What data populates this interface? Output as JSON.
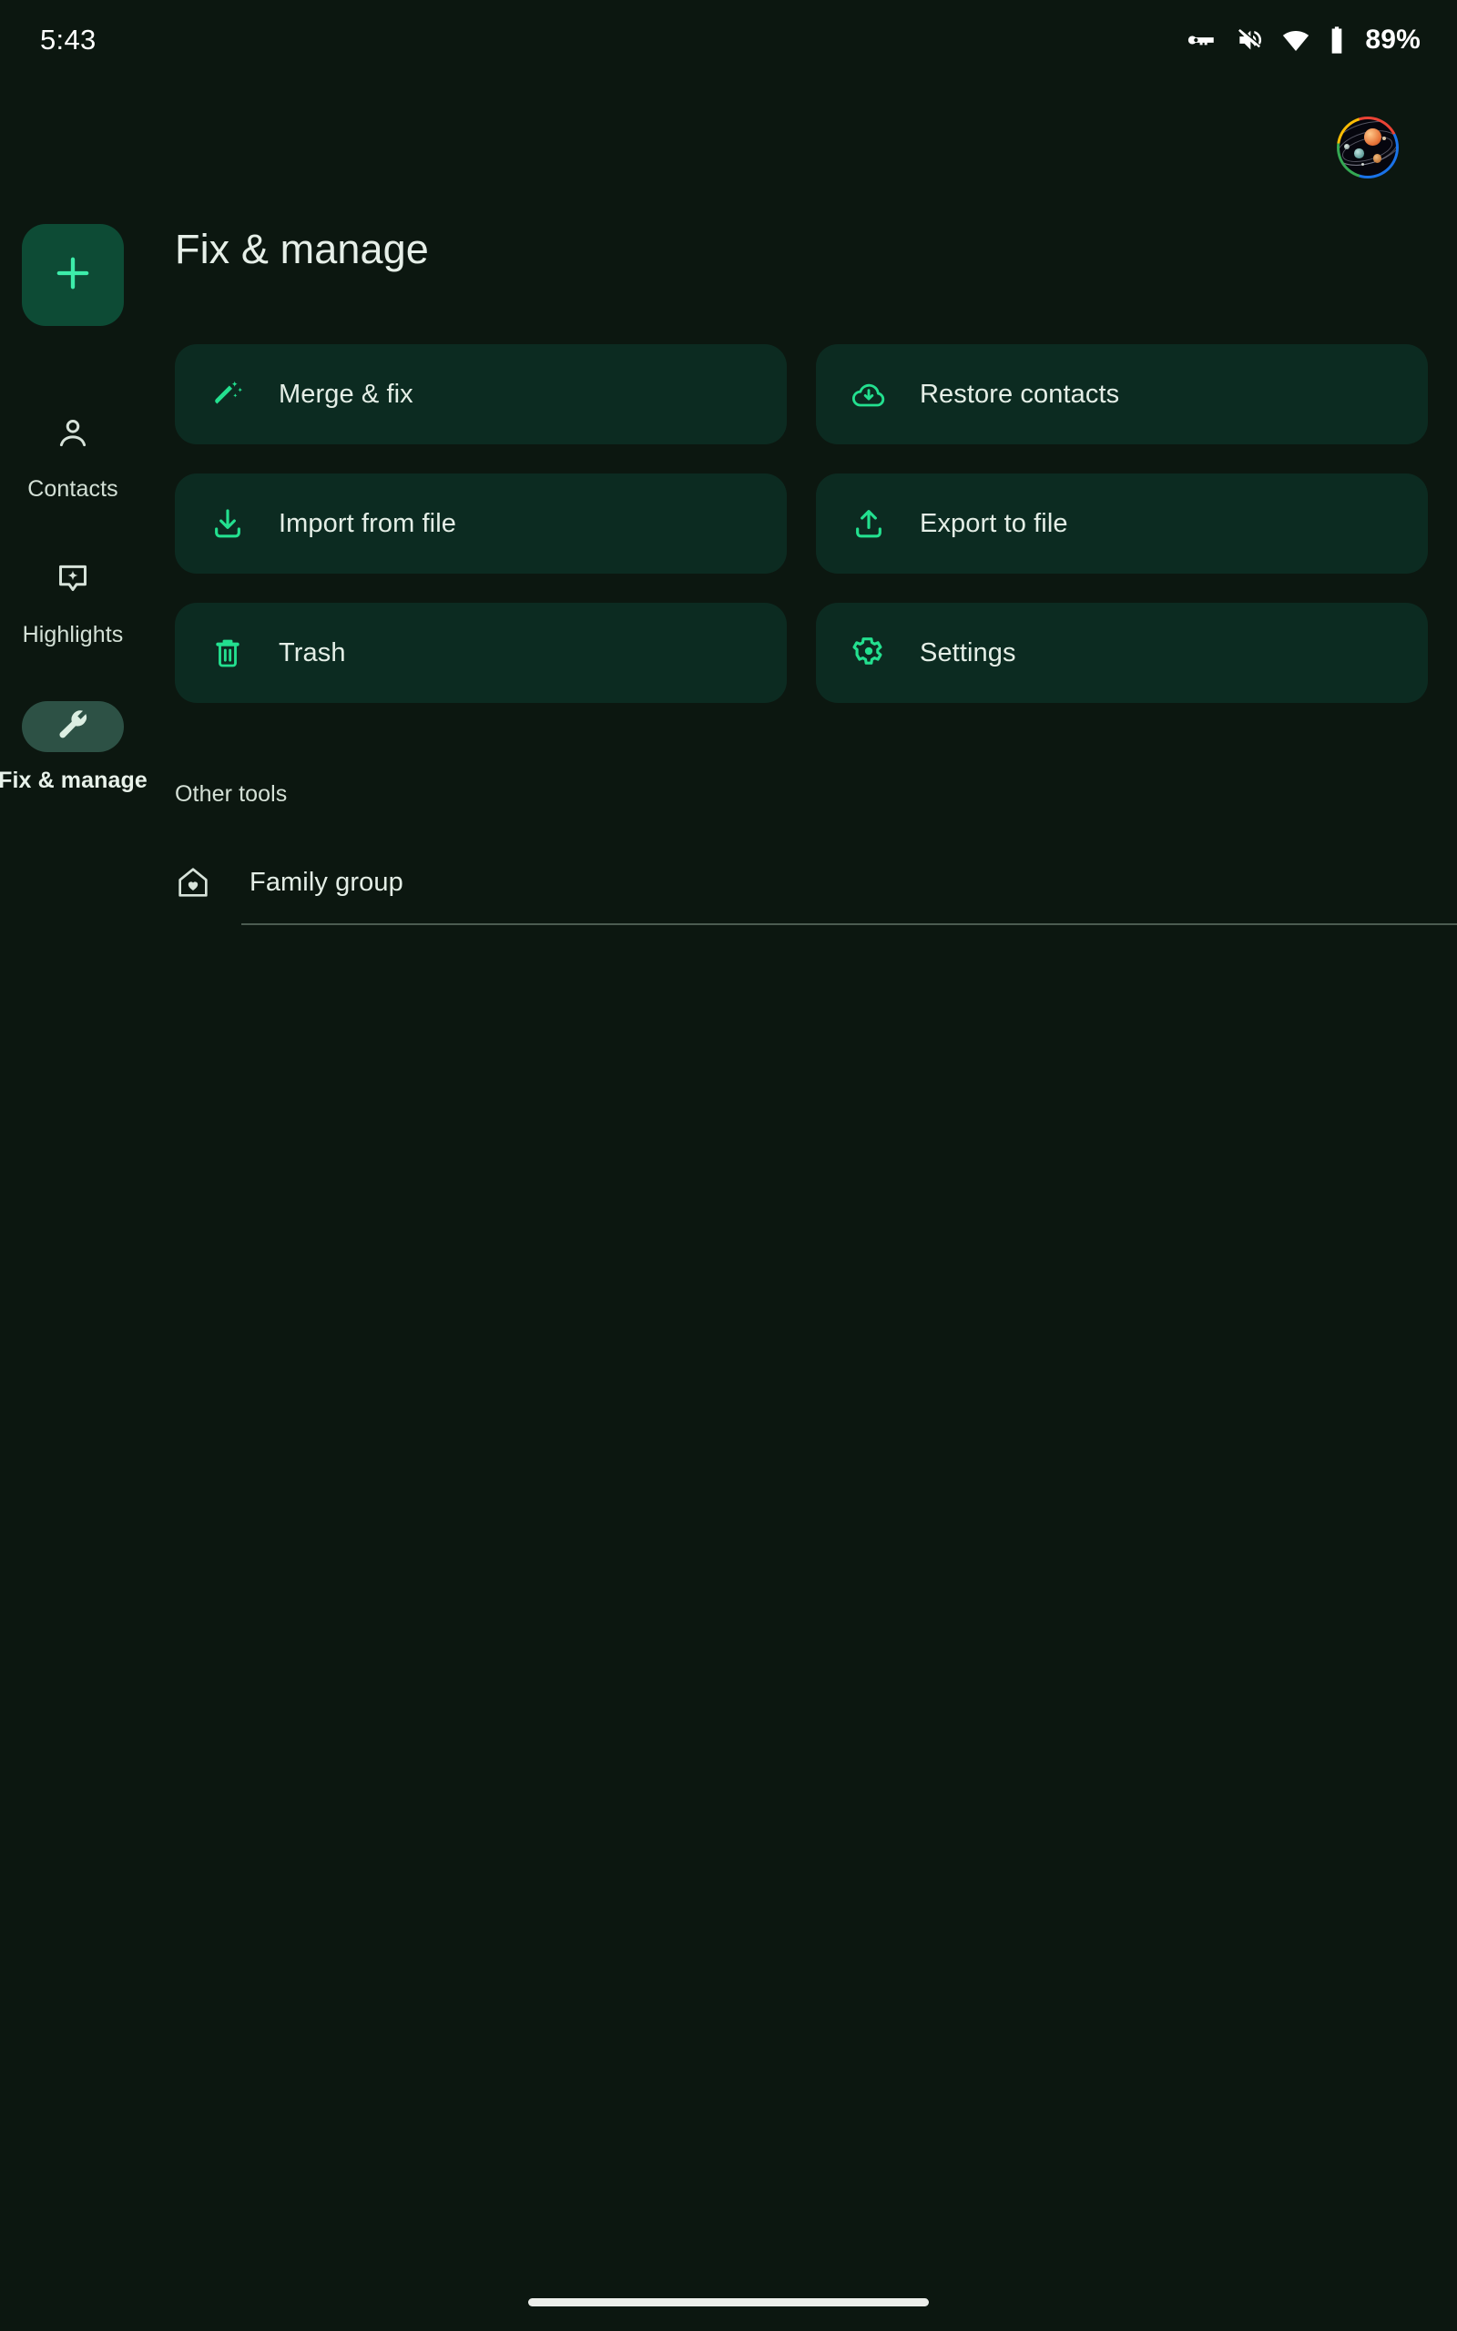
{
  "status_bar": {
    "time": "5:43",
    "battery_percent": "89%",
    "icons": [
      "vpn-key-icon",
      "volume-muted-icon",
      "wifi-icon",
      "battery-icon"
    ]
  },
  "account": {
    "avatar_name": "account-avatar",
    "ring_colors": [
      "#ea4335",
      "#fbbc04",
      "#34a853",
      "#1a73e8"
    ]
  },
  "rail": {
    "fab": {
      "label": "Create contact",
      "icon": "plus-icon"
    },
    "items": [
      {
        "id": "contacts",
        "label": "Contacts",
        "icon": "person-icon",
        "selected": false
      },
      {
        "id": "highlights",
        "label": "Highlights",
        "icon": "highlights-icon",
        "selected": false
      },
      {
        "id": "fix",
        "label": "Fix & manage",
        "icon": "wrench-icon",
        "selected": true
      }
    ]
  },
  "main": {
    "title": "Fix & manage",
    "tools": [
      {
        "label": "Merge & fix",
        "icon": "magic-wand-icon"
      },
      {
        "label": "Restore contacts",
        "icon": "cloud-download-icon"
      },
      {
        "label": "Import from file",
        "icon": "download-icon"
      },
      {
        "label": "Export to file",
        "icon": "upload-icon"
      },
      {
        "label": "Trash",
        "icon": "trash-icon"
      },
      {
        "label": "Settings",
        "icon": "gear-icon"
      }
    ],
    "other_tools_heading": "Other tools",
    "other_tools": [
      {
        "label": "Family group",
        "icon": "house-heart-icon"
      }
    ]
  },
  "colors": {
    "background": "#0c1710",
    "card": "#0c2b21",
    "accent_green": "#23e08f",
    "fab": "#0d4b35",
    "selected_pill": "#2d5145",
    "text_primary": "#e4eee6",
    "divider": "#4c5c51"
  }
}
